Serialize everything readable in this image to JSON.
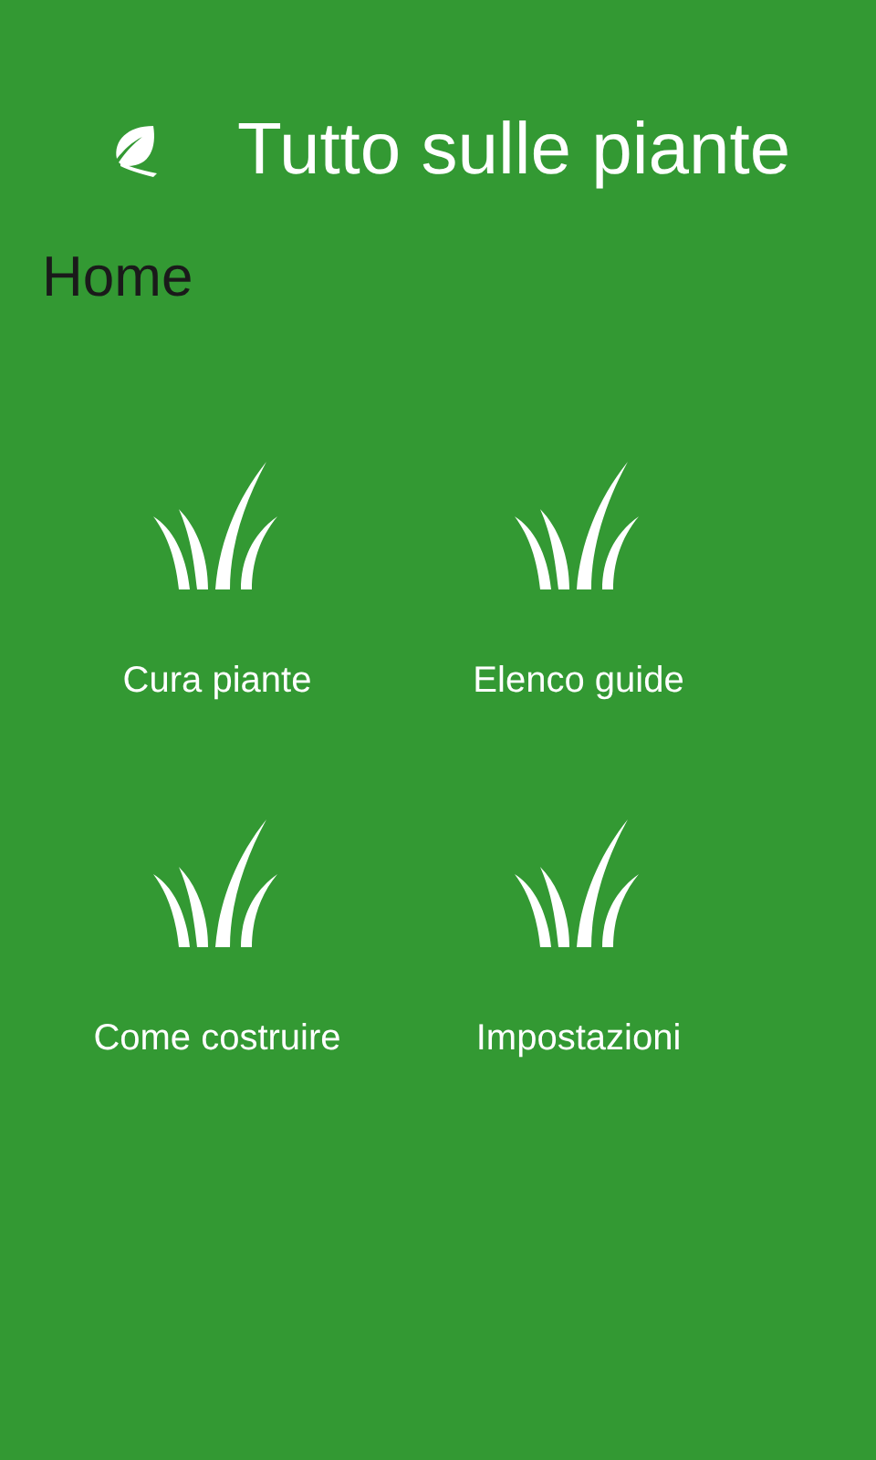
{
  "header": {
    "title": "Tutto sulle piante"
  },
  "page": {
    "title": "Home"
  },
  "tiles": [
    {
      "label": "Cura piante"
    },
    {
      "label": "Elenco guide"
    },
    {
      "label": "Come costruire"
    },
    {
      "label": "Impostazioni"
    }
  ]
}
